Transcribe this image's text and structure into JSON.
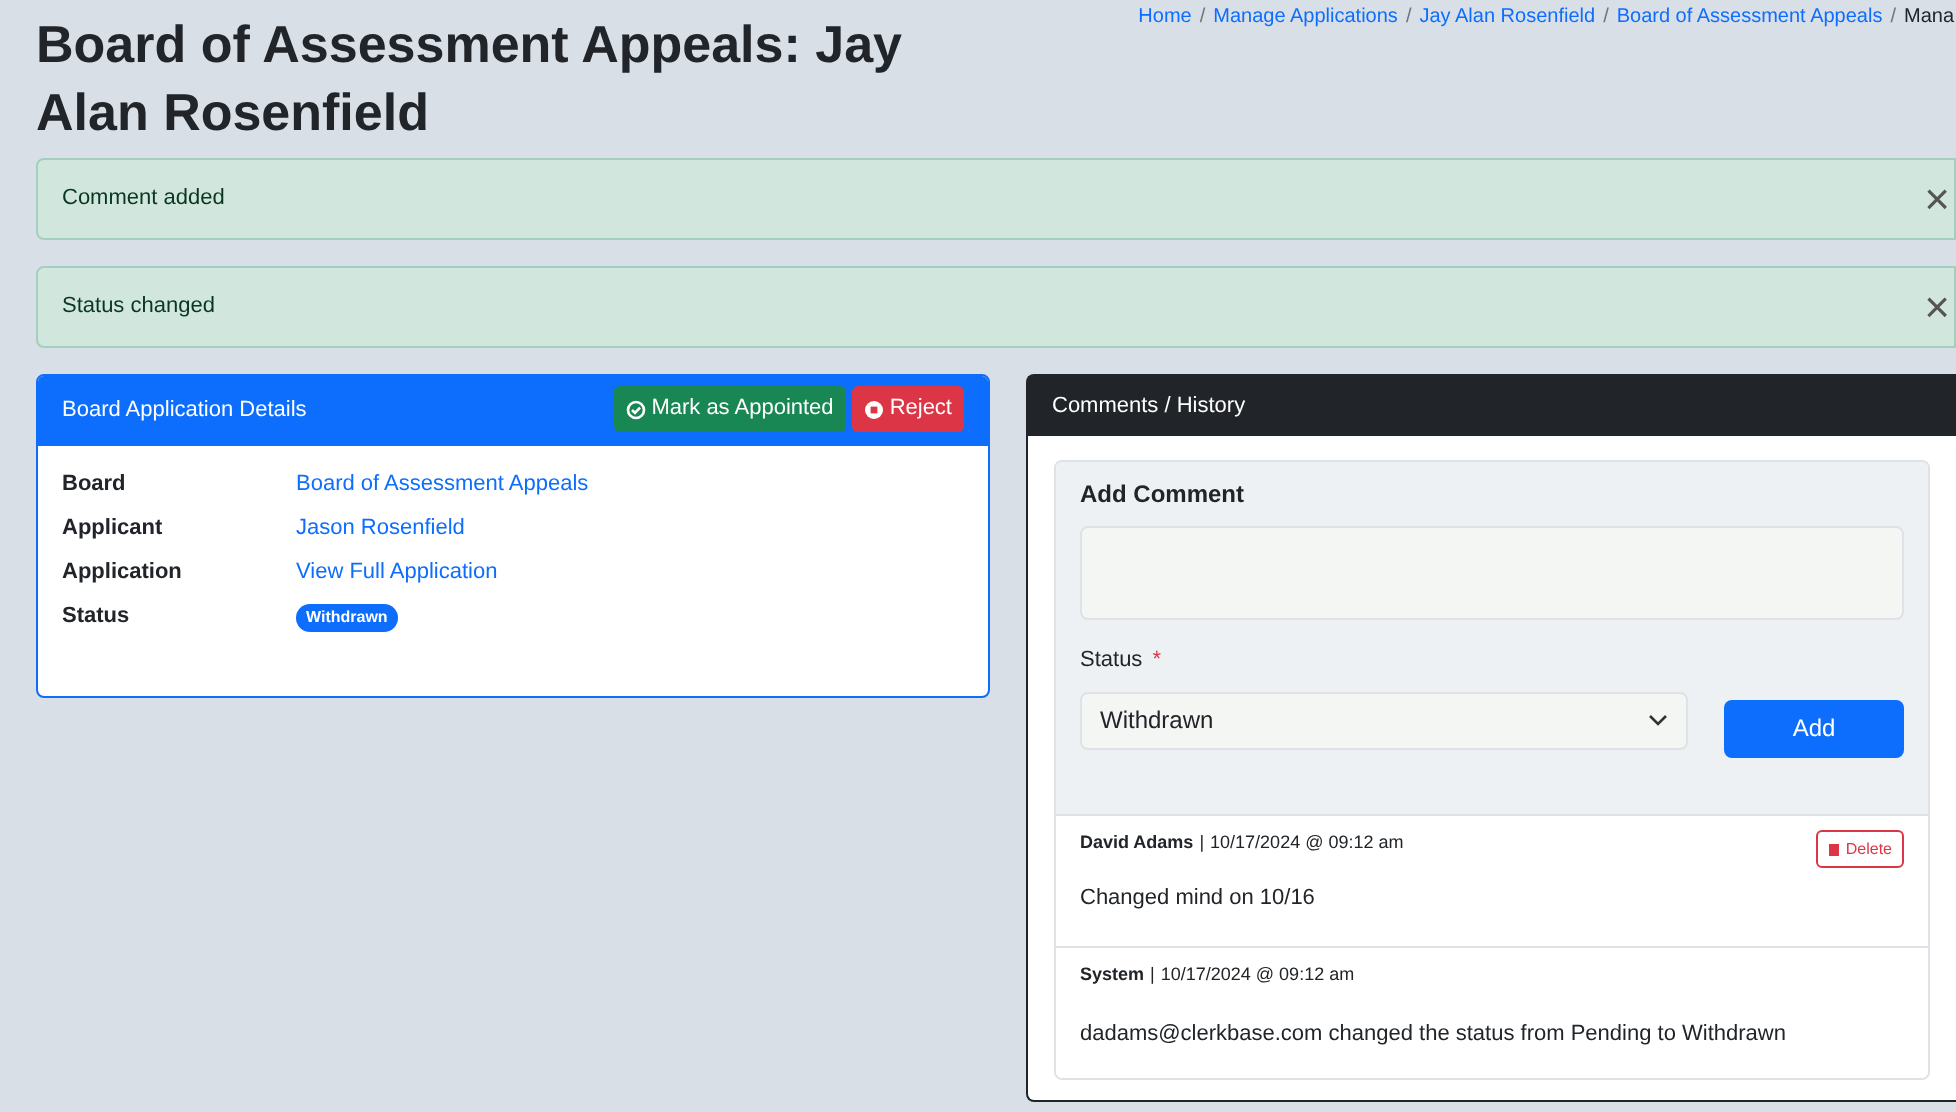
{
  "title": "Board of Assessment Appeals: Jay Alan Rosenfield",
  "breadcrumb_separator": "/",
  "breadcrumb": [
    {
      "label": "Home",
      "link": true
    },
    {
      "label": "Manage Applications",
      "link": true
    },
    {
      "label": "Jay Alan Rosenfield",
      "link": true
    },
    {
      "label": "Board of Assessment Appeals",
      "link": true
    },
    {
      "label": "Mana",
      "link": false
    }
  ],
  "alerts": [
    {
      "text": "Comment added",
      "close": "×"
    },
    {
      "text": "Status changed",
      "close": "×"
    }
  ],
  "details": {
    "title": "Board Application Details",
    "appoint_button": "Mark as Appointed",
    "reject_button": "Reject",
    "rows": [
      {
        "label": "Board",
        "value": "Board of Assessment Appeals",
        "kind": "link"
      },
      {
        "label": "Applicant",
        "value": "Jason Rosenfield",
        "kind": "link"
      },
      {
        "label": "Application",
        "value": "View Full Application",
        "kind": "link"
      },
      {
        "label": "Status",
        "value": "Withdrawn",
        "kind": "badge"
      }
    ]
  },
  "comments": {
    "title": "Comments / History",
    "form_title": "Add Comment",
    "status_label": "Status",
    "required_mark": "*",
    "status_value": "Withdrawn",
    "add_button": "Add",
    "entries": [
      {
        "author": "David Adams",
        "separator": "|",
        "time": "10/17/2024 @ 09:12 am",
        "text": "Changed mind on 10/16",
        "kind": "user",
        "delete": "Delete"
      },
      {
        "author": "System",
        "separator": "|",
        "time": "10/17/2024 @ 09:12 am",
        "text": "dadams@clerkbase.com changed the status from Pending to Withdrawn",
        "kind": "system"
      }
    ]
  }
}
